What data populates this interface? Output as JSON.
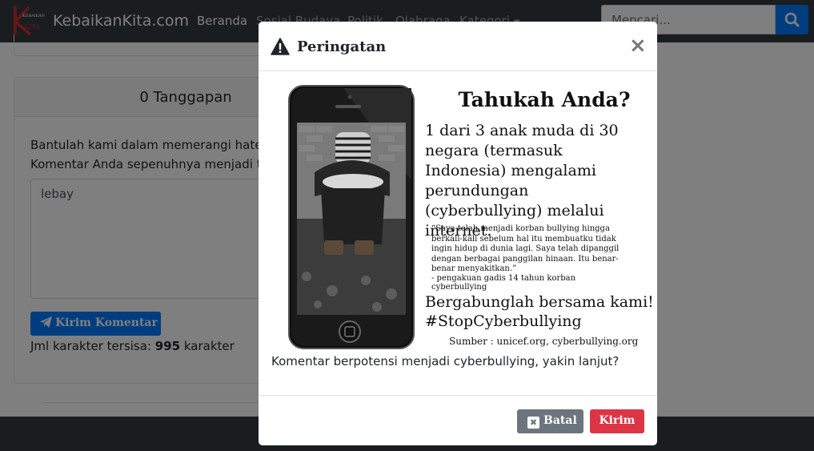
{
  "navbar": {
    "logo_text": "KEBAIKAN KITA",
    "brand": "KebaikanKita.com",
    "links": [
      "Beranda",
      "Sosial Budaya",
      "Politik",
      "Olahraga",
      "Kategori"
    ],
    "search_placeholder": "Mencari..."
  },
  "card": {
    "header": "0 Tanggapan",
    "line1": "Bantulah kami dalam memerangi hatespeech dan cyberbullying.",
    "line2": "Komentar Anda sepenuhnya menjadi tanggung jawab Anda.",
    "comment_value": "lebay",
    "send_label": "Kirim Komentar",
    "remaining_prefix": "Jml karakter tersisa:",
    "remaining_count": "995",
    "remaining_suffix": "karakter"
  },
  "modal": {
    "title": "Peringatan",
    "close": "×",
    "promo": {
      "heading": "Tahukah Anda?",
      "fact": "1 dari 3 anak muda di 30 negara (termasuk Indonesia) mengalami perundungan (cyberbullying) melalui internet.",
      "quote": "“Saya telah menjadi korban bullying hingga berkali-kali sebelum hal itu membuatku tidak ingin hidup di dunia lagi. Saya telah dipanggil dengan berbagai panggilan hinaan. Itu benar-benar menyakitkan.”",
      "attribution": "- pengakuan gadis 14 tahun korban cyberbullying",
      "cta": "Bergabunglah bersama kami!",
      "hashtag": "#StopCyberbullying",
      "source": "Sumber : unicef.org, cyberbullying.org"
    },
    "confirm_text": "Komentar berpotensi menjadi cyberbullying, yakin lanjut?",
    "cancel_label": "Batal",
    "submit_label": "Kirim"
  },
  "colors": {
    "navbar": "#343a40",
    "primary": "#007bff",
    "danger": "#dc3545",
    "secondary": "#6c757d"
  }
}
